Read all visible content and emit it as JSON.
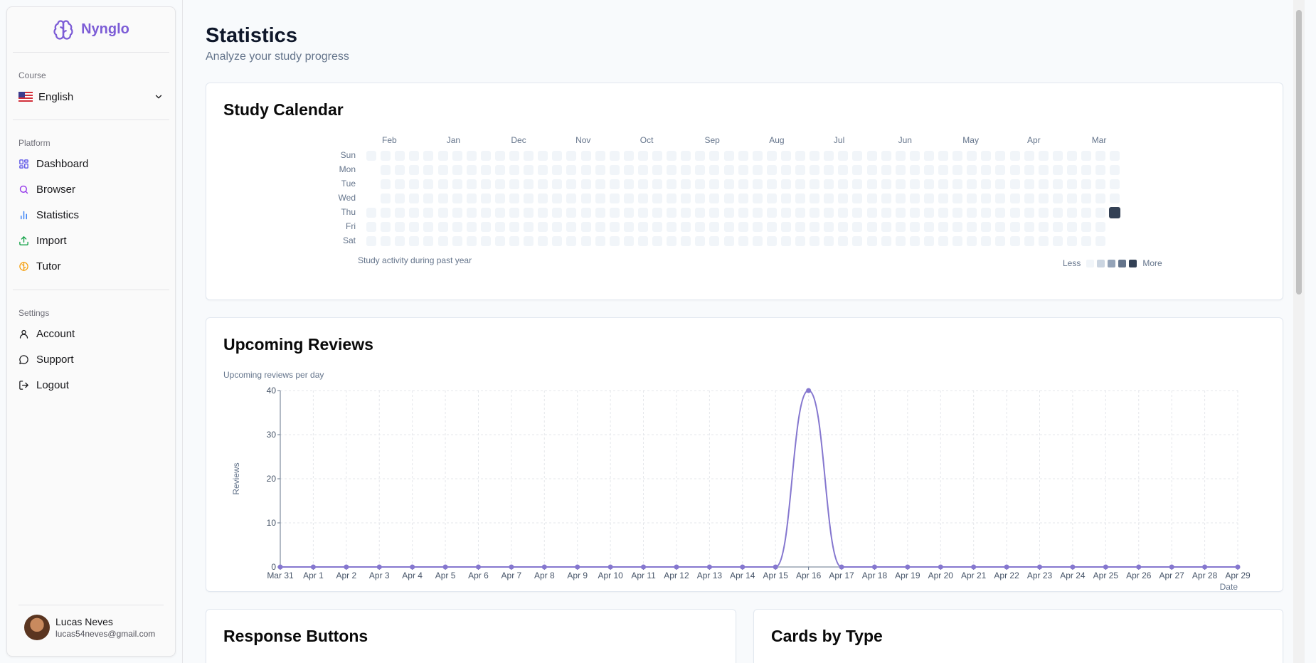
{
  "app": {
    "name": "Nynglo"
  },
  "sidebar": {
    "course_label": "Course",
    "course_value": "English",
    "platform_label": "Platform",
    "platform_items": [
      {
        "label": "Dashboard",
        "icon": "dashboard-icon"
      },
      {
        "label": "Browser",
        "icon": "search-icon"
      },
      {
        "label": "Statistics",
        "icon": "bar-chart-icon"
      },
      {
        "label": "Import",
        "icon": "upload-icon"
      },
      {
        "label": "Tutor",
        "icon": "brain-icon"
      }
    ],
    "settings_label": "Settings",
    "settings_items": [
      {
        "label": "Account",
        "icon": "user-icon"
      },
      {
        "label": "Support",
        "icon": "message-icon"
      },
      {
        "label": "Logout",
        "icon": "logout-icon"
      }
    ],
    "user": {
      "name": "Lucas Neves",
      "email": "lucas54neves@gmail.com"
    }
  },
  "page": {
    "title": "Statistics",
    "subtitle": "Analyze your study progress"
  },
  "calendar": {
    "title": "Study Calendar",
    "months": [
      "Feb",
      "Jan",
      "Dec",
      "Nov",
      "Oct",
      "Sep",
      "Aug",
      "Jul",
      "Jun",
      "May",
      "Apr",
      "Mar"
    ],
    "days": [
      "Sun",
      "Mon",
      "Tue",
      "Wed",
      "Thu",
      "Fri",
      "Sat"
    ],
    "caption": "Study activity during past year",
    "legend_less": "Less",
    "legend_more": "More",
    "legend_colors": [
      "#f1f5f9",
      "#cbd5e1",
      "#94a3b8",
      "#64748b",
      "#334155"
    ],
    "active_cell": {
      "week_from_right": 0,
      "day": "Thu",
      "level": 4
    }
  },
  "reviews": {
    "title": "Upcoming Reviews",
    "subtitle": "Upcoming reviews per day",
    "line_color": "#8577cf"
  },
  "chart_data": {
    "type": "line",
    "ylabel": "Reviews",
    "xlabel": "Date",
    "ylim": [
      0,
      40
    ],
    "yticks": [
      0,
      10,
      20,
      30,
      40
    ],
    "grid": true,
    "categories": [
      "Mar 31",
      "Apr 1",
      "Apr 2",
      "Apr 3",
      "Apr 4",
      "Apr 5",
      "Apr 6",
      "Apr 7",
      "Apr 8",
      "Apr 9",
      "Apr 10",
      "Apr 11",
      "Apr 12",
      "Apr 13",
      "Apr 14",
      "Apr 15",
      "Apr 16",
      "Apr 17",
      "Apr 18",
      "Apr 19",
      "Apr 20",
      "Apr 21",
      "Apr 22",
      "Apr 23",
      "Apr 24",
      "Apr 25",
      "Apr 26",
      "Apr 27",
      "Apr 28",
      "Apr 29"
    ],
    "values": [
      0,
      0,
      0,
      0,
      0,
      0,
      0,
      0,
      0,
      0,
      0,
      0,
      0,
      0,
      0,
      0,
      40,
      0,
      0,
      0,
      0,
      0,
      0,
      0,
      0,
      0,
      0,
      0,
      0,
      0
    ]
  },
  "response_buttons": {
    "title": "Response Buttons"
  },
  "cards_by_type": {
    "title": "Cards by Type"
  }
}
